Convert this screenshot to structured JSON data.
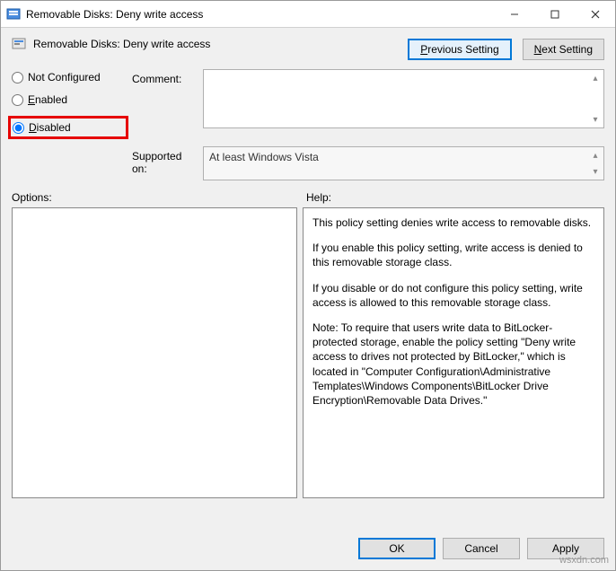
{
  "window": {
    "title": "Removable Disks: Deny write access"
  },
  "header": {
    "subtitle": "Removable Disks: Deny write access",
    "prev_btn": "Previous Setting",
    "next_btn": "Next Setting"
  },
  "state": {
    "not_configured_label": "Not Configured",
    "enabled_label": "Enabled",
    "disabled_label": "Disabled",
    "selected": "disabled"
  },
  "labels": {
    "comment": "Comment:",
    "supported": "Supported on:",
    "options": "Options:",
    "help": "Help:"
  },
  "fields": {
    "comment_value": "",
    "supported_value": "At least Windows Vista"
  },
  "help": {
    "p1": "This policy setting denies write access to removable disks.",
    "p2": "If you enable this policy setting, write access is denied to this removable storage class.",
    "p3": "If you disable or do not configure this policy setting, write access is allowed to this removable storage class.",
    "p4": "Note: To require that users write data to BitLocker-protected storage, enable the policy setting \"Deny write access to drives not protected by BitLocker,\" which is located in \"Computer Configuration\\Administrative Templates\\Windows Components\\BitLocker Drive Encryption\\Removable Data Drives.\""
  },
  "buttons": {
    "ok": "OK",
    "cancel": "Cancel",
    "apply": "Apply"
  },
  "watermark": "wsxdn.com"
}
